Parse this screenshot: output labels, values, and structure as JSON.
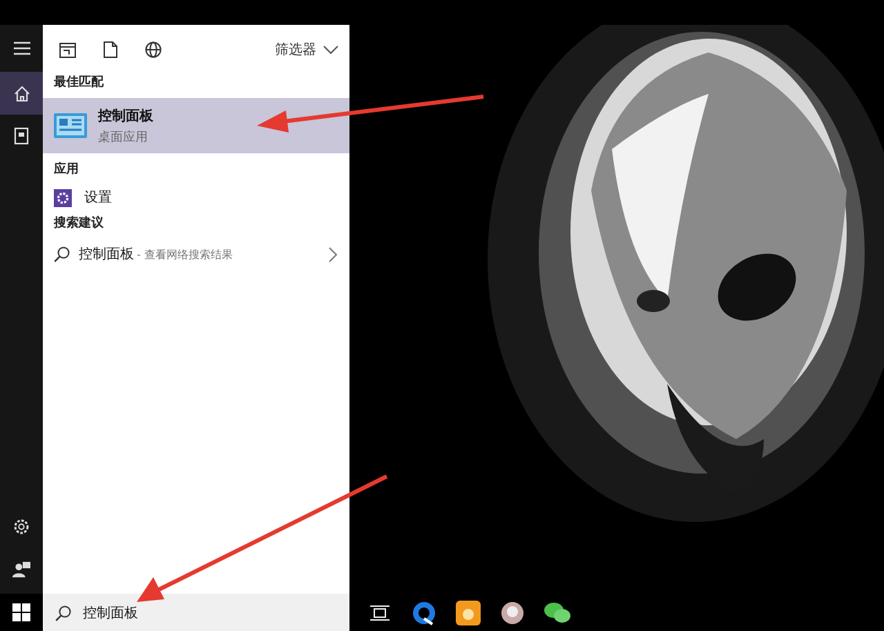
{
  "rail": {
    "top": [
      {
        "kind": "menu",
        "selected": false
      },
      {
        "kind": "home",
        "selected": true
      },
      {
        "kind": "documents",
        "selected": false
      }
    ],
    "bottom": [
      {
        "kind": "settings",
        "selected": false
      },
      {
        "kind": "account",
        "selected": false
      }
    ]
  },
  "toolbar": {
    "scopes": [
      {
        "kind": "apps"
      },
      {
        "kind": "documents"
      },
      {
        "kind": "web"
      }
    ],
    "filter_label": "筛选器"
  },
  "sections": [
    {
      "heading": "最佳匹配",
      "items": [
        {
          "kind": "best",
          "title": "控制面板",
          "subtitle": "桌面应用",
          "selected": true
        }
      ]
    },
    {
      "heading": "应用",
      "items": [
        {
          "kind": "app",
          "title": "设置",
          "selected": false
        }
      ]
    },
    {
      "heading": "搜索建议",
      "items": [
        {
          "kind": "web",
          "title": "控制面板",
          "suffix": "- 查看网络搜索结果",
          "selected": false
        }
      ]
    }
  ],
  "search": {
    "value": "控制面板"
  },
  "taskbar": {
    "icons": [
      {
        "kind": "taskview"
      },
      {
        "kind": "browser"
      },
      {
        "kind": "orange"
      },
      {
        "kind": "round"
      },
      {
        "kind": "chat"
      }
    ]
  }
}
